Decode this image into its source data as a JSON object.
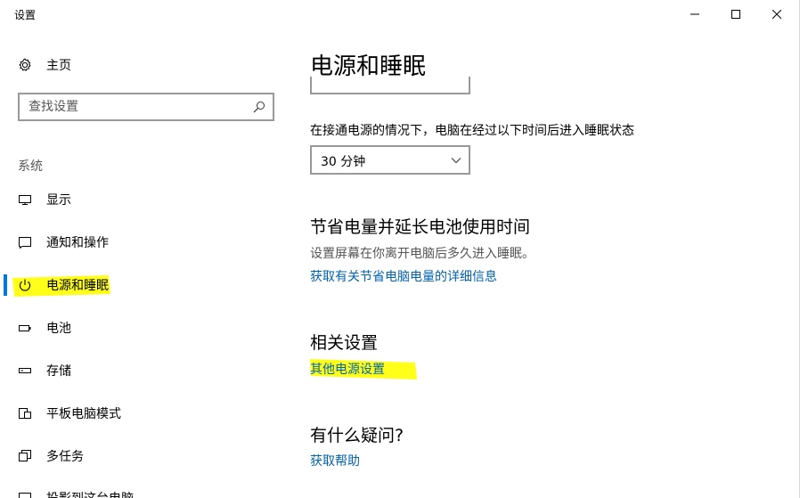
{
  "window": {
    "title": "设置",
    "controls": {
      "minimize": "minimize-icon",
      "maximize": "maximize-icon",
      "close": "close-icon"
    }
  },
  "sidebar": {
    "home": {
      "label": "主页",
      "icon": "gear-icon"
    },
    "search": {
      "placeholder": "查找设置",
      "value": "",
      "icon": "search-icon"
    },
    "section_label": "系统",
    "items": [
      {
        "label": "显示",
        "icon": "monitor-icon",
        "active": false
      },
      {
        "label": "通知和操作",
        "icon": "notification-icon",
        "active": false
      },
      {
        "label": "电源和睡眠",
        "icon": "power-icon",
        "active": true
      },
      {
        "label": "电池",
        "icon": "battery-icon",
        "active": false
      },
      {
        "label": "存储",
        "icon": "storage-icon",
        "active": false
      },
      {
        "label": "平板电脑模式",
        "icon": "tablet-mode-icon",
        "active": false
      },
      {
        "label": "多任务",
        "icon": "multitasking-icon",
        "active": false
      },
      {
        "label": "投影到这台电脑",
        "icon": "projecting-icon",
        "active": false
      }
    ]
  },
  "main": {
    "title": "电源和睡眠",
    "sleep": {
      "label": "在接通电源的情况下，电脑在经过以下时间后进入睡眠状态",
      "dropdown_value": "30 分钟"
    },
    "save_battery": {
      "title": "节省电量并延长电池使用时间",
      "description": "设置屏幕在你离开电脑后多久进入睡眠。",
      "link": "获取有关节省电脑电量的详细信息"
    },
    "related": {
      "title": "相关设置",
      "link": "其他电源设置"
    },
    "question": {
      "title": "有什么疑问?",
      "link": "获取帮助"
    }
  },
  "colors": {
    "accent": "#0078d7",
    "link": "#0063b1",
    "highlighter": "#ffff00",
    "border": "#999999",
    "secondary_text": "#555555"
  }
}
